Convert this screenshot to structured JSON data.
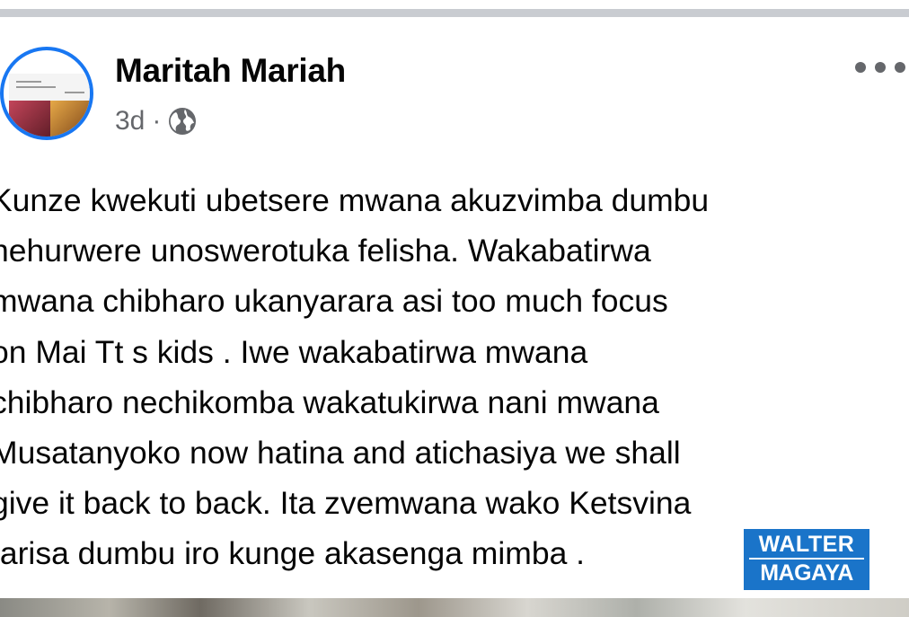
{
  "post": {
    "author": "Maritah Mariah",
    "timestamp": "3d",
    "separator": "·",
    "privacy_icon": "globe-icon",
    "more_icon": "more-options-icon",
    "lines": [
      "Kunze kwekuti ubetsere mwana akuzvimba dumbu",
      "nehurwere unoswerotuka felisha. Wakabatirwa",
      "mwana chibharo ukanyarara asi too much focus",
      "on Mai Tt s kids . Iwe wakabatirwa mwana",
      "chibharo nechikomba wakatukirwa nani mwana",
      "Musatanyoko now hatina and atichasiya we shall",
      "give it back to back. Ita zvemwana wako Ketsvina",
      "tarisa dumbu iro kunge akasenga mimba ."
    ]
  },
  "watermark": {
    "line1": "WALTER",
    "line2": "MAGAYA"
  },
  "colors": {
    "avatar_ring": "#1877f2",
    "secondary_text": "#65676b",
    "watermark_bg": "#1a74c9",
    "divider": "#c9ccd1"
  }
}
